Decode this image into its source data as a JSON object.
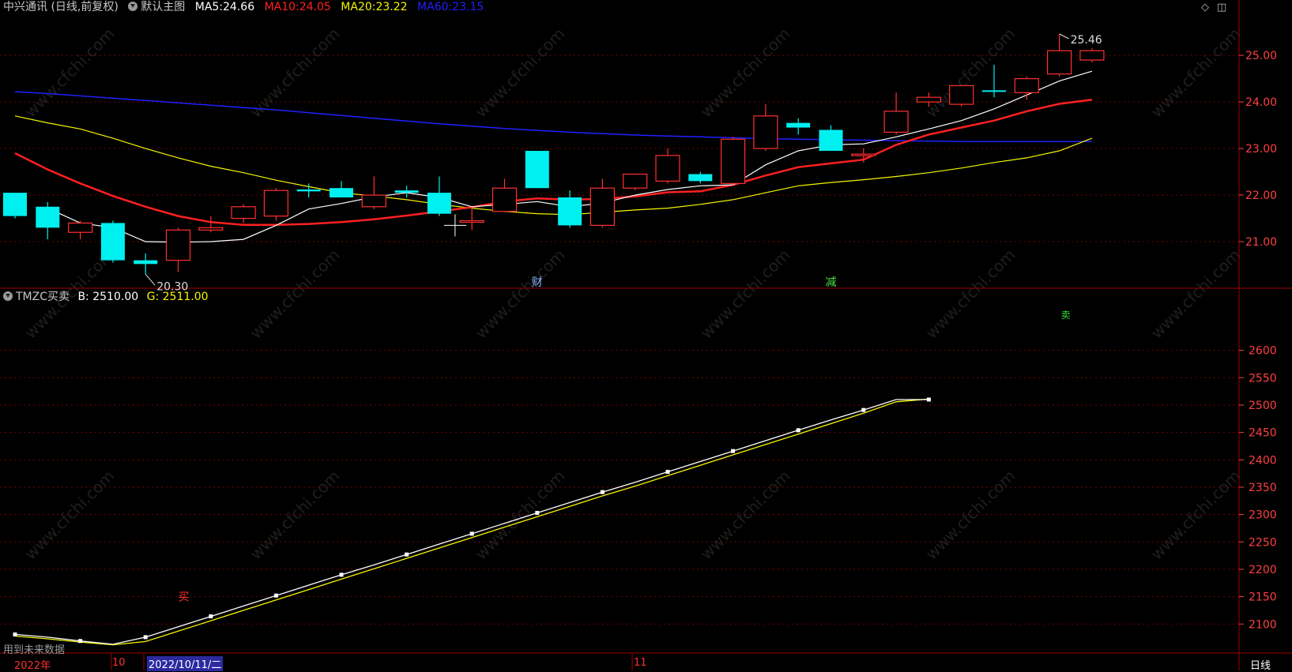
{
  "main_panel": {
    "title": "中兴通讯 (日线,前复权)",
    "template": "默认主图",
    "ma5": {
      "label": "MA5:",
      "value": "24.66",
      "color": "#ffffff"
    },
    "ma10": {
      "label": "MA10:",
      "value": "24.05",
      "color": "#ff2020"
    },
    "ma20": {
      "label": "MA20:",
      "value": "23.22",
      "color": "#f5f500"
    },
    "ma60": {
      "label": "MA60:",
      "value": "23.15",
      "color": "#2020ff"
    },
    "high_marker": "25.46",
    "low_marker": "20.30",
    "event_cai": "财",
    "event_jian": "减",
    "watermark": "www.cfchi.com"
  },
  "sub_panel": {
    "name": "TMZC买卖",
    "b": {
      "label": "B:",
      "value": "2510.00",
      "color": "#ffffff"
    },
    "g": {
      "label": "G:",
      "value": "2511.00",
      "color": "#f5f500"
    },
    "buy_label": "买",
    "sell_label": "卖",
    "future_note": "用到未来数据"
  },
  "footer": {
    "year": "2022年",
    "month10": "10",
    "cursor_date": "2022/10/11/二",
    "month11": "11",
    "period": "日线"
  },
  "colors": {
    "up": "#ff3030",
    "down": "#00f0f0",
    "grid": "#7a0000",
    "axis_text": "#ff4040"
  },
  "chart_data": [
    {
      "type": "candlestick",
      "yticks": [
        21.0,
        22.0,
        23.0,
        24.0,
        25.0
      ],
      "ylim": [
        20.0,
        25.85
      ],
      "candles": [
        {
          "o": 22.05,
          "h": 22.05,
          "l": 21.5,
          "c": 21.55
        },
        {
          "o": 21.75,
          "h": 21.85,
          "l": 21.05,
          "c": 21.3
        },
        {
          "o": 21.2,
          "h": 21.45,
          "l": 21.05,
          "c": 21.4
        },
        {
          "o": 21.4,
          "h": 21.45,
          "l": 20.55,
          "c": 20.6
        },
        {
          "o": 20.6,
          "h": 20.75,
          "l": 20.3,
          "c": 20.52
        },
        {
          "o": 20.6,
          "h": 21.3,
          "l": 20.35,
          "c": 21.25
        },
        {
          "o": 21.25,
          "h": 21.55,
          "l": 21.2,
          "c": 21.3
        },
        {
          "o": 21.5,
          "h": 21.8,
          "l": 21.4,
          "c": 21.75
        },
        {
          "o": 21.55,
          "h": 22.15,
          "l": 21.45,
          "c": 22.1
        },
        {
          "o": 22.12,
          "h": 22.25,
          "l": 21.95,
          "c": 22.08
        },
        {
          "o": 22.15,
          "h": 22.3,
          "l": 21.95,
          "c": 21.95
        },
        {
          "o": 21.75,
          "h": 22.4,
          "l": 21.7,
          "c": 22.0
        },
        {
          "o": 22.1,
          "h": 22.2,
          "l": 21.95,
          "c": 22.05
        },
        {
          "o": 22.05,
          "h": 22.4,
          "l": 21.55,
          "c": 21.6
        },
        {
          "o": 21.45,
          "h": 21.7,
          "l": 21.25,
          "c": 21.45
        },
        {
          "o": 21.65,
          "h": 22.35,
          "l": 21.65,
          "c": 22.15
        },
        {
          "o": 22.95,
          "h": 22.95,
          "l": 22.15,
          "c": 22.15
        },
        {
          "o": 21.95,
          "h": 22.1,
          "l": 21.3,
          "c": 21.35
        },
        {
          "o": 21.35,
          "h": 22.35,
          "l": 21.3,
          "c": 22.15
        },
        {
          "o": 22.15,
          "h": 22.45,
          "l": 22.1,
          "c": 22.45
        },
        {
          "o": 22.3,
          "h": 23.0,
          "l": 22.25,
          "c": 22.85
        },
        {
          "o": 22.45,
          "h": 22.5,
          "l": 22.25,
          "c": 22.3
        },
        {
          "o": 22.25,
          "h": 23.25,
          "l": 22.2,
          "c": 23.2
        },
        {
          "o": 23.0,
          "h": 23.95,
          "l": 22.95,
          "c": 23.7
        },
        {
          "o": 23.55,
          "h": 23.65,
          "l": 23.3,
          "c": 23.45
        },
        {
          "o": 23.4,
          "h": 23.5,
          "l": 22.95,
          "c": 22.95
        },
        {
          "o": 22.85,
          "h": 23.0,
          "l": 22.7,
          "c": 22.88
        },
        {
          "o": 23.35,
          "h": 24.2,
          "l": 23.3,
          "c": 23.8
        },
        {
          "o": 24.0,
          "h": 24.2,
          "l": 23.9,
          "c": 24.1
        },
        {
          "o": 23.95,
          "h": 24.35,
          "l": 23.9,
          "c": 24.35
        },
        {
          "o": 24.25,
          "h": 24.8,
          "l": 24.1,
          "c": 24.22
        },
        {
          "o": 24.2,
          "h": 24.55,
          "l": 24.05,
          "c": 24.5
        },
        {
          "o": 24.6,
          "h": 25.46,
          "l": 24.55,
          "c": 25.1
        },
        {
          "o": 24.9,
          "h": 25.15,
          "l": 24.85,
          "c": 25.1
        }
      ],
      "ma5": [
        null,
        21.72,
        21.4,
        21.3,
        21.0,
        20.99,
        21.0,
        21.05,
        21.35,
        21.7,
        21.82,
        21.96,
        22.05,
        21.95,
        21.75,
        21.8,
        21.86,
        21.75,
        21.83,
        22.0,
        22.12,
        22.2,
        22.22,
        22.65,
        22.95,
        23.08,
        23.1,
        23.25,
        23.42,
        23.6,
        23.85,
        24.15,
        24.45,
        24.66
      ],
      "ma10": [
        22.9,
        22.55,
        22.25,
        21.98,
        21.75,
        21.55,
        21.42,
        21.36,
        21.36,
        21.38,
        21.42,
        21.48,
        21.56,
        21.65,
        21.74,
        21.86,
        21.93,
        21.9,
        21.92,
        21.97,
        22.06,
        22.08,
        22.22,
        22.42,
        22.6,
        22.68,
        22.76,
        23.08,
        23.3,
        23.45,
        23.6,
        23.8,
        23.96,
        24.05
      ],
      "ma20": [
        23.7,
        23.55,
        23.42,
        23.22,
        23.0,
        22.8,
        22.62,
        22.48,
        22.32,
        22.18,
        22.05,
        21.98,
        21.9,
        21.8,
        21.72,
        21.65,
        21.6,
        21.58,
        21.63,
        21.68,
        21.72,
        21.8,
        21.9,
        22.05,
        22.2,
        22.27,
        22.33,
        22.4,
        22.48,
        22.58,
        22.7,
        22.8,
        22.95,
        23.22
      ],
      "ma60": [
        24.22,
        24.18,
        24.13,
        24.08,
        24.03,
        23.98,
        23.93,
        23.88,
        23.83,
        23.77,
        23.71,
        23.65,
        23.59,
        23.53,
        23.48,
        23.43,
        23.39,
        23.35,
        23.32,
        23.29,
        23.27,
        23.25,
        23.23,
        23.21,
        23.2,
        23.19,
        23.18,
        23.17,
        23.16,
        23.15,
        23.15,
        23.15,
        23.15,
        23.15
      ]
    },
    {
      "type": "line",
      "yticks": [
        2100,
        2150,
        2200,
        2250,
        2300,
        2350,
        2400,
        2450,
        2500,
        2550,
        2600
      ],
      "ylim": [
        2047,
        2686
      ],
      "series": [
        {
          "name": "B",
          "values": [
            2081,
            2076,
            2069,
            2063,
            2076,
            2095,
            2114,
            2133,
            2152,
            2171,
            2190,
            2208,
            2227,
            2246,
            2265,
            2284,
            2303,
            2322,
            2341,
            2359,
            2378,
            2397,
            2416,
            2435,
            2454,
            2473,
            2491,
            2510,
            2510
          ]
        },
        {
          "name": "G",
          "values": [
            2078,
            2073,
            2067,
            2062,
            2068,
            2087,
            2106,
            2125,
            2144,
            2163,
            2182,
            2201,
            2220,
            2239,
            2258,
            2277,
            2296,
            2315,
            2334,
            2352,
            2371,
            2390,
            2409,
            2428,
            2447,
            2466,
            2485,
            2506,
            2511
          ]
        }
      ]
    }
  ]
}
